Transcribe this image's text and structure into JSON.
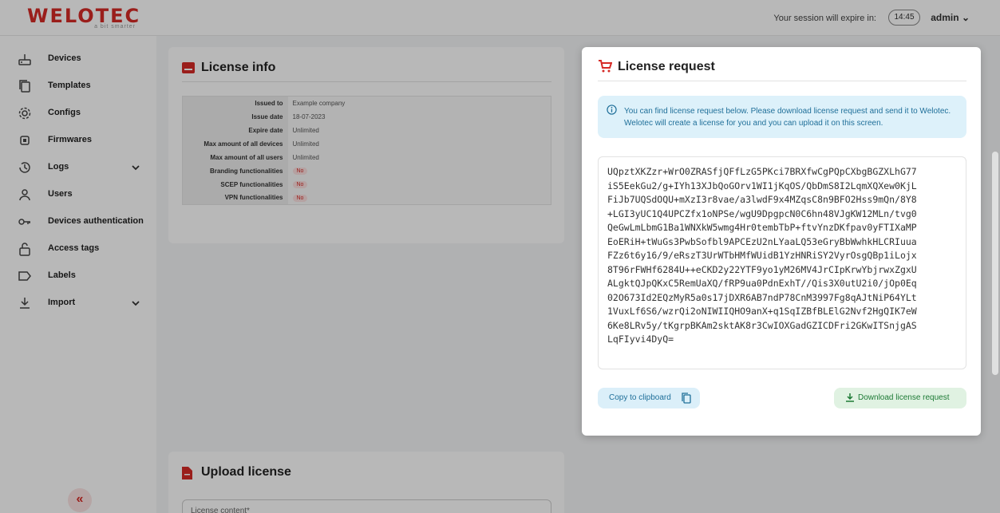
{
  "header": {
    "logo_text": "WELOTEC",
    "logo_tagline": "a bit smarter",
    "session_label": "Your session will expire in:",
    "session_time": "14:45",
    "user_name": "admin"
  },
  "sidebar": {
    "items": [
      {
        "label": "Devices",
        "icon": "router-icon"
      },
      {
        "label": "Templates",
        "icon": "copy-icon"
      },
      {
        "label": "Configs",
        "icon": "gear-icon"
      },
      {
        "label": "Firmwares",
        "icon": "chip-icon"
      },
      {
        "label": "Logs",
        "icon": "history-icon"
      },
      {
        "label": "Users",
        "icon": "user-icon"
      },
      {
        "label": "Devices authentication",
        "icon": "key-icon"
      },
      {
        "label": "Access tags",
        "icon": "lock-icon"
      },
      {
        "label": "Labels",
        "icon": "label-icon"
      },
      {
        "label": "Import",
        "icon": "import-icon"
      }
    ],
    "collapse_label": "«"
  },
  "license_info": {
    "title": "License info",
    "rows": [
      {
        "key": "Issued to",
        "value": "Example company"
      },
      {
        "key": "Issue date",
        "value": "18-07-2023"
      },
      {
        "key": "Expire date",
        "value": "Unlimited"
      },
      {
        "key": "Max amount of all devices",
        "value": "Unlimited"
      },
      {
        "key": "Max amount of all users",
        "value": "Unlimited"
      },
      {
        "key": "Branding functionalities",
        "value": "No"
      },
      {
        "key": "SCEP functionalities",
        "value": "No"
      },
      {
        "key": "VPN functionalities",
        "value": "No"
      }
    ]
  },
  "upload_license": {
    "title": "Upload license",
    "field_label": "License content*"
  },
  "modal": {
    "title": "License request",
    "alert_text": "You can find license request below. Please download license request and send it to Welotec. Welotec will create a license for you and you can upload it on this screen.",
    "request_lines": [
      "UQpztXKZzr+WrO0ZRASfjQFfLzG5PKci7BRXfwCgPQpCXbgBGZXLhG77",
      "iS5EekGu2/g+IYh13XJbQoGOrv1WI1jKqOS/QbDmS8I2LqmXQXew0KjL",
      "FiJb7UQSdOQU+mXzI3r8vae/a3lwdF9x4MZqsC8n9BFO2Hss9mQn/8Y8",
      "+LGI3yUC1Q4UPCZfx1oNPSe/wgU9DpgpcN0C6hn48VJgKW12MLn/tvg0",
      "QeGwLmLbmG1Ba1WNXkW5wmg4Hr0tembTbP+ftvYnzDKfpav0yFTIXaMP",
      "EoERiH+tWuGs3PwbSofbl9APCEzU2nLYaaLQ53eGryBbWwhkHLCRIuua",
      "FZz6t6y16/9/eRszT3UrWTbHMfWUidB1YzHNRiSY2VyrOsgQBp1iLojx",
      "8T96rFWHf6284U++eCKD2y22YTF9yo1yM26MV4JrCIpKrwYbjrwxZgxU",
      "ALgktQJpQKxC5RemUaXQ/fRP9ua0PdnExhT//Qis3X0utU2i0/jOp0Eq",
      "02O673Id2EQzMyR5a0s17jDXR6AB7ndP78CnM3997Fg8qAJtNiP64YLt",
      "1VuxLf6S6/wzrQi2oNIWIIQHO9anX+q1SqIZBfBLElG2Nvf2HgQIK7eW",
      "6Ke8LRv5y/tKgrpBKAm2sktAK8r3CwIOXGadGZICDFri2GKwITSnjgAS",
      "LqFIyvi4DyQ="
    ],
    "copy_label": "Copy to clipboard",
    "download_label": "Download license request"
  },
  "colors": {
    "brand": "#d62a26",
    "info": "#1f6f99",
    "success": "#1d7a35"
  }
}
